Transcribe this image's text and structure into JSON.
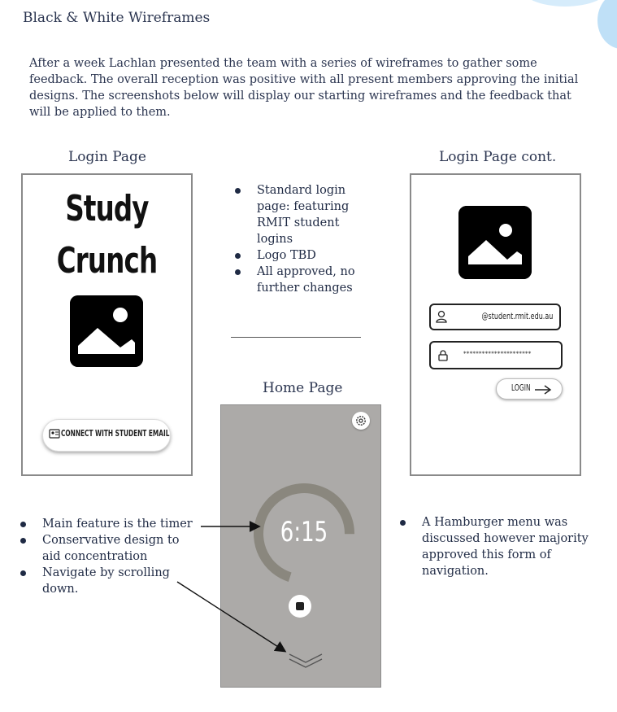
{
  "page": {
    "title": "Black & White Wireframes",
    "intro": "After a week Lachlan presented the team with a series of wireframes to gather some feedback. The overall reception was positive with all present members approving the initial designs. The screenshots below will display our starting wireframes and the feedback that will be applied to them."
  },
  "login_page": {
    "heading": "Login Page",
    "app_name_line1": "Study",
    "app_name_line2": "Crunch",
    "image_icon": "image-placeholder-icon",
    "connect_button": "CONNECT WITH STUDENT EMAIL",
    "email_icon": "id-card-icon"
  },
  "login_notes": [
    "Standard login page: featuring RMIT student logins",
    "Logo TBD",
    "All approved, no further changes"
  ],
  "login_cont": {
    "heading": "Login Page cont.",
    "email_value": "@student.rmit.edu.au",
    "password_value": "**********************",
    "login_button": "LOGIN",
    "user_icon": "user-icon",
    "lock_icon": "lock-icon",
    "arrow_icon": "arrow-right-icon"
  },
  "home_page": {
    "heading": "Home Page",
    "timer": "6:15",
    "timer_progress": 0.7,
    "settings_icon": "gear-icon",
    "stop_icon": "stop-icon",
    "scroll_icon": "chevron-down-icon"
  },
  "home_notes": [
    "Main feature is the timer",
    "Conservative design to aid concentration",
    "Navigate by scrolling down."
  ],
  "nav_notes": [
    "A Hamburger menu was discussed however majority approved this form of navigation."
  ]
}
